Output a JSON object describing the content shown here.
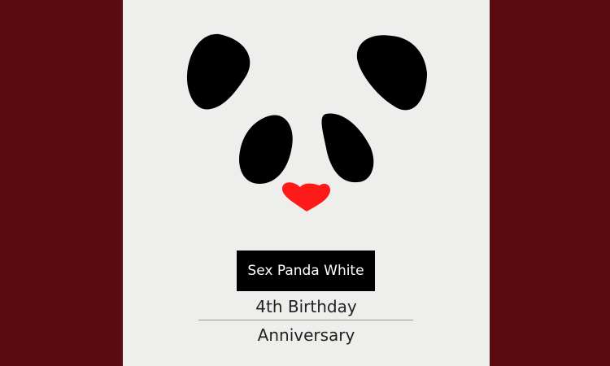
{
  "colors": {
    "outer_frame": "#5b0c11",
    "panel": "#eeeeec",
    "panda_black": "#000000",
    "heart_red": "#ff1a1a",
    "label_text": "#ffffff"
  },
  "badge": {
    "title": "Sex Panda White"
  },
  "caption": {
    "line1": "4th Birthday",
    "line2": "Anniversary"
  },
  "graphic": {
    "subject": "panda-face",
    "parts": [
      "left-ear",
      "right-ear",
      "left-eye-patch",
      "right-eye-patch",
      "heart-nose"
    ]
  }
}
